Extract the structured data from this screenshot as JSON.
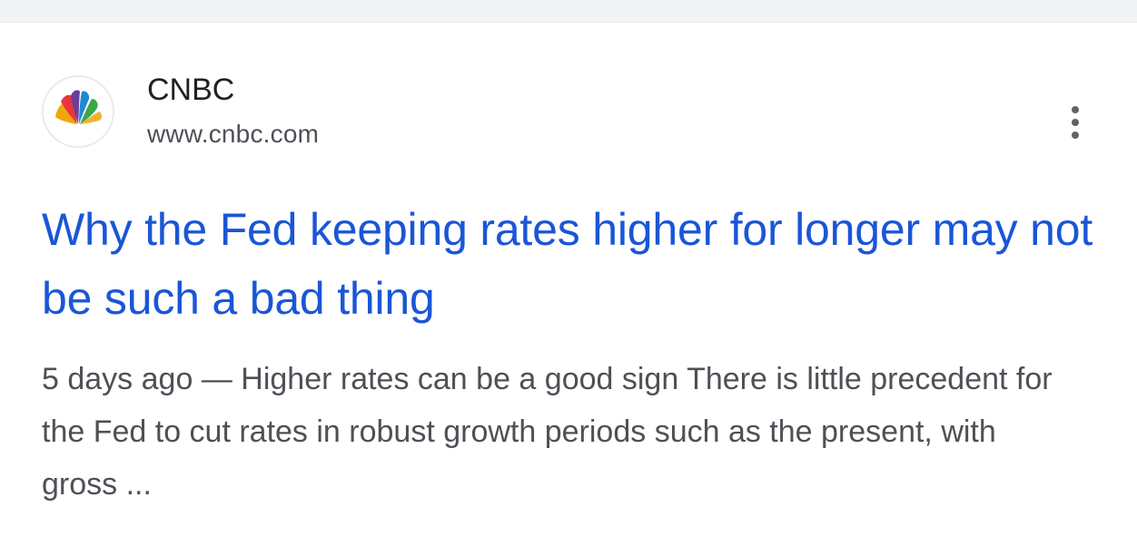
{
  "result": {
    "source": {
      "name": "CNBC",
      "url": "www.cnbc.com",
      "favicon_icon": "cnbc-peacock-icon"
    },
    "more_options_icon": "more-vert-icon",
    "headline": "Why the Fed keeping rates higher for longer may not be such a bad thing",
    "snippet": {
      "date": "5 days ago",
      "separator": "—",
      "text": "Higher rates can be a good sign There is little precedent for the Fed to cut rates in robust growth periods such as the present, with gross ..."
    },
    "colors": {
      "headline": "#1a56d6",
      "snippet": "#4d5156",
      "source_name": "#202124",
      "background": "#ffffff",
      "top_strip": "#f1f3f4"
    }
  }
}
